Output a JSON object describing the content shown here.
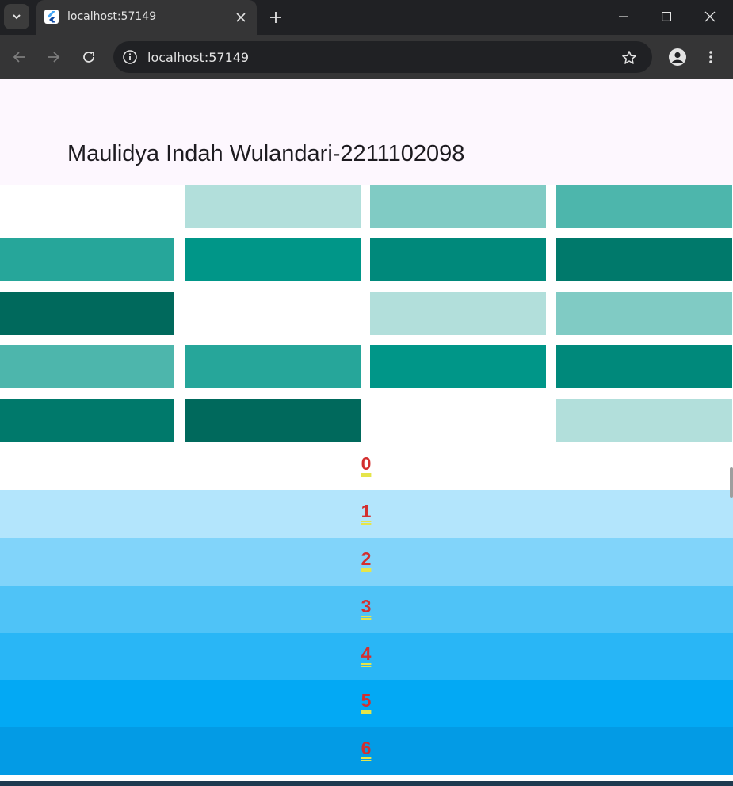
{
  "browser": {
    "tab_title": "localhost:57149",
    "url": "localhost:57149",
    "icons": {
      "tab_search": "chevron-down-icon",
      "favicon": "flutter-icon",
      "tab_close": "close-icon",
      "new_tab": "plus-icon",
      "minimize": "minimize-icon",
      "maximize": "maximize-icon",
      "close_window": "close-icon",
      "back": "arrow-left-icon",
      "forward": "arrow-right-icon",
      "reload": "reload-icon",
      "site_info": "info-icon",
      "bookmark": "star-icon",
      "profile": "profile-icon",
      "menu": "more-vert-icon"
    },
    "colors": {
      "tabstrip": "#202124",
      "toolbar": "#353536",
      "omnibox": "#202124",
      "text": "#e3e3e3"
    }
  },
  "app": {
    "title": "Maulidya Indah Wulandari-2211102098",
    "appbar_color": "#fdf7fe",
    "grid_colors": [
      "#ffffff",
      "#b2dfdb",
      "#80cbc4",
      "#4db6ac",
      "#26a69a",
      "#009688",
      "#00897b",
      "#00796b",
      "#00695c",
      "#ffffff",
      "#b2dfdb",
      "#80cbc4",
      "#4db6ac",
      "#26a69a",
      "#009688",
      "#00897b",
      "#00796b",
      "#00695c",
      "#ffffff",
      "#b2dfdb"
    ],
    "list_items": [
      {
        "label": "0",
        "color": "#ffffff"
      },
      {
        "label": "1",
        "color": "#b3e5fc"
      },
      {
        "label": "2",
        "color": "#81d4fa"
      },
      {
        "label": "3",
        "color": "#4fc3f7"
      },
      {
        "label": "4",
        "color": "#29b6f6"
      },
      {
        "label": "5",
        "color": "#03a9f4"
      },
      {
        "label": "6",
        "color": "#039be5"
      }
    ],
    "list_text_color": "#d32f2f"
  }
}
